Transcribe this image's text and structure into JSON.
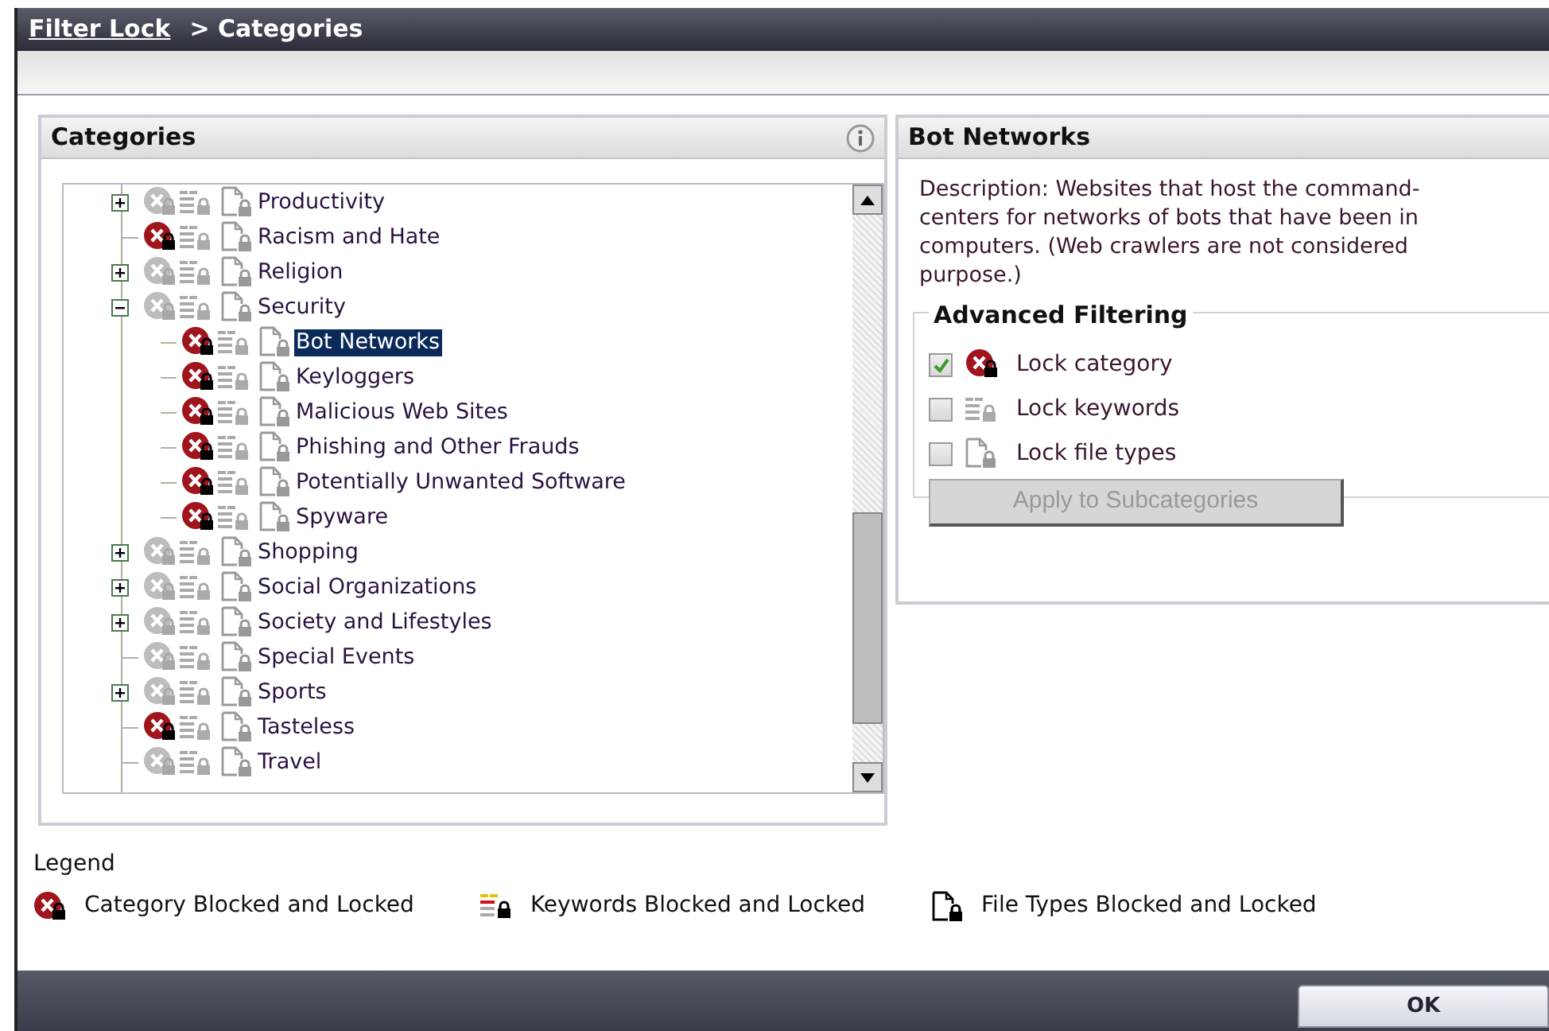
{
  "breadcrumb": {
    "link": "Filter Lock",
    "current": "> Categories"
  },
  "categories_panel": {
    "title": "Categories",
    "tree": [
      {
        "label": "Productivity",
        "category_locked": false,
        "expanded": false,
        "selected": false
      },
      {
        "label": "Racism and Hate",
        "category_locked": true,
        "selected": false
      },
      {
        "label": "Religion",
        "category_locked": false,
        "expanded": false,
        "selected": false
      },
      {
        "label": "Security",
        "category_locked": false,
        "expanded": true,
        "selected": false,
        "children": [
          {
            "label": "Bot Networks",
            "category_locked": true,
            "selected": true
          },
          {
            "label": "Keyloggers",
            "category_locked": true,
            "selected": false
          },
          {
            "label": "Malicious Web Sites",
            "category_locked": true,
            "selected": false
          },
          {
            "label": "Phishing and Other Frauds",
            "category_locked": true,
            "selected": false
          },
          {
            "label": "Potentially Unwanted Software",
            "category_locked": true,
            "selected": false
          },
          {
            "label": "Spyware",
            "category_locked": true,
            "selected": false
          }
        ]
      },
      {
        "label": "Shopping",
        "category_locked": false,
        "expanded": false,
        "selected": false
      },
      {
        "label": "Social Organizations",
        "category_locked": false,
        "expanded": false,
        "selected": false
      },
      {
        "label": "Society and Lifestyles",
        "category_locked": false,
        "expanded": false,
        "selected": false
      },
      {
        "label": "Special Events",
        "category_locked": false,
        "selected": false
      },
      {
        "label": "Sports",
        "category_locked": false,
        "expanded": false,
        "selected": false
      },
      {
        "label": "Tasteless",
        "category_locked": true,
        "selected": false
      },
      {
        "label": "Travel",
        "category_locked": false,
        "selected": false
      }
    ]
  },
  "details_panel": {
    "title": "Bot Networks",
    "description_lines": [
      "Description: Websites that host the command-",
      "centers for networks of bots that have been in",
      "computers. (Web crawlers are not considered",
      "purpose.)"
    ],
    "advanced_filtering": {
      "title": "Advanced Filtering",
      "options": [
        {
          "kind": "category",
          "label": "Lock category",
          "checked": true
        },
        {
          "kind": "keywords",
          "label": "Lock keywords",
          "checked": false
        },
        {
          "kind": "file_types",
          "label": "Lock file types",
          "checked": false
        }
      ],
      "apply_button": {
        "label": "Apply to Subcategories",
        "disabled": true
      }
    }
  },
  "legend": {
    "title": "Legend",
    "items": [
      {
        "kind": "category",
        "label": "Category Blocked and Locked"
      },
      {
        "kind": "keywords",
        "label": "Keywords Blocked and Locked"
      },
      {
        "kind": "file_types",
        "label": "File Types Blocked and Locked"
      }
    ]
  },
  "footer": {
    "ok_button": "OK"
  }
}
